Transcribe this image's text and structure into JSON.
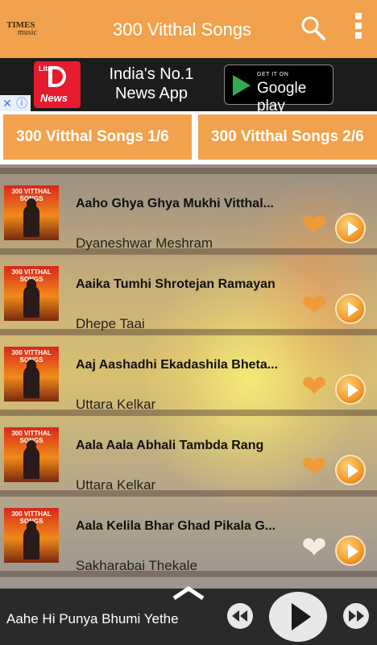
{
  "appbar": {
    "logo_top": "TIMES",
    "logo_bottom": "music",
    "title": "300 Vitthal Songs",
    "search_icon": "search-icon",
    "menu_icon": "more-vertical-icon"
  },
  "ad": {
    "logo_lite": "Lite",
    "logo_name": "News",
    "headline": "India's No.1 News App",
    "store_small": "GET IT ON",
    "store_big": "Google play",
    "close_glyph": "✕",
    "info_glyph": "ⓘ"
  },
  "tabs": [
    {
      "label": "300 Vitthal Songs 1/6"
    },
    {
      "label": "300 Vitthal Songs 2/6"
    }
  ],
  "songs": [
    {
      "title": "Aaho Ghya Ghya Mukhi Vitthal...",
      "artist": "Dyaneshwar Meshram",
      "thumb_text": "300 VITTHAL SONGS",
      "favorite": true
    },
    {
      "title": "Aaika Tumhi Shrotejan Ramayan",
      "artist": "Dhepe Taai",
      "thumb_text": "300 VITTHAL SONGS",
      "favorite": true
    },
    {
      "title": "Aaj Aashadhi Ekadashila Bheta...",
      "artist": "Uttara Kelkar",
      "thumb_text": "300 VITTHAL SONGS",
      "favorite": true
    },
    {
      "title": "Aala Aala Abhali Tambda Rang",
      "artist": "Uttara Kelkar",
      "thumb_text": "300 VITTHAL SONGS",
      "favorite": true
    },
    {
      "title": "Aala Kelila Bhar Ghad Pikala G...",
      "artist": "Sakharabai Thekale",
      "thumb_text": "300 VITTHAL SONGS",
      "favorite": false
    }
  ],
  "player": {
    "now_playing": "Aahe Hi Punya Bhumi Yethe",
    "prev_icon": "rewind-icon",
    "play_icon": "play-icon",
    "next_icon": "fast-forward-icon",
    "expand_icon": "chevron-up-icon"
  },
  "colors": {
    "accent": "#f2a24c",
    "heart_favorite": "#f09a3a",
    "heart_empty": "#f4ece0",
    "player_bg": "#2a2a2a"
  }
}
